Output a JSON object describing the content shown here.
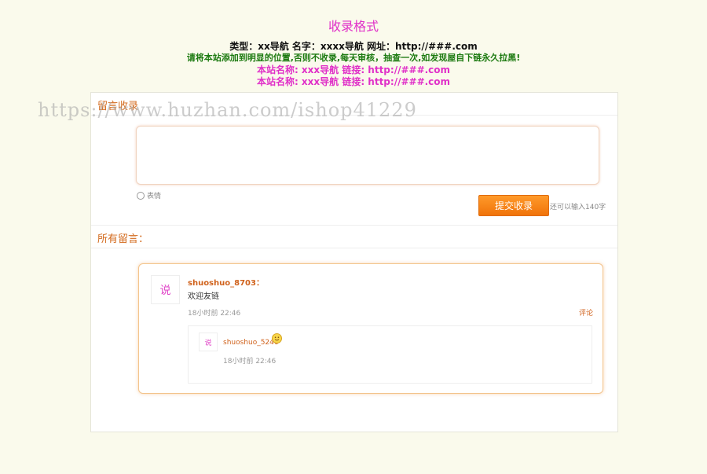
{
  "header": {
    "title": "收录格式",
    "format_line": "类型：xx导航  名字：xxxx导航  网址：http://###.com",
    "warning": "请将本站添加到明显的位置,否则不收录,每天审核，抽查一次,如发现屋自下链永久拉黑!",
    "example_lines": [
      "本站名称: xxx导航  链接: http://###.com",
      "本站名称: xxx导航  链接: http://###.com"
    ]
  },
  "form": {
    "section_title": "留言收录",
    "textarea_value": "",
    "emoji_label": "表情",
    "submit_label": "提交收录",
    "hint": "还可以输入140字"
  },
  "comments": {
    "section_title": "所有留言：",
    "items": [
      {
        "avatar_text": "说",
        "username": "shuoshuo_8703：",
        "text": "欢迎友链",
        "time": "18小时前 22:46",
        "reply_label": "评论",
        "replies": [
          {
            "avatar_text": "说",
            "username": "shuoshuo_5246",
            "time": "18小时前 22:46"
          }
        ]
      }
    ]
  },
  "watermark": "https://www.huzhan.com/ishop41229",
  "colors": {
    "accent": "#d36a1d",
    "button": "#f0730a",
    "title": "#e030c8",
    "warning": "#1c7a10",
    "background": "#fafaec"
  }
}
